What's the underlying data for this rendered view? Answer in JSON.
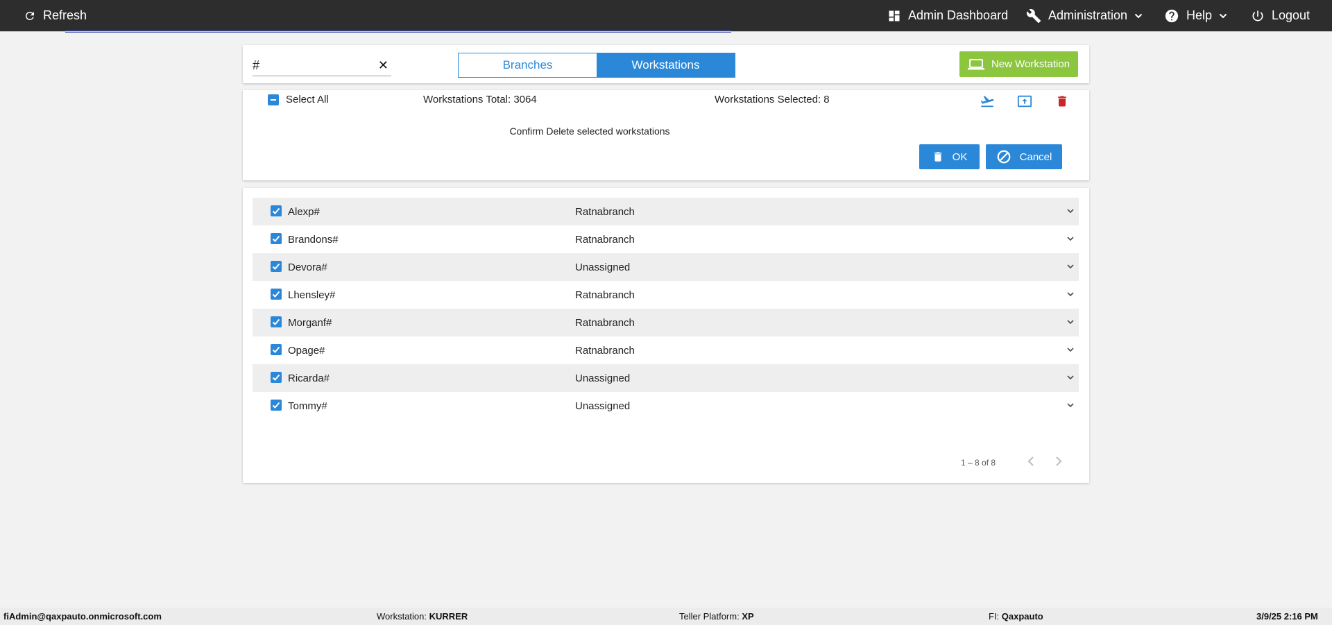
{
  "topbar": {
    "refresh": "Refresh",
    "admin_dashboard": "Admin Dashboard",
    "administration": "Administration",
    "help": "Help",
    "logout": "Logout"
  },
  "search": {
    "value": "#"
  },
  "toggle": {
    "branches": "Branches",
    "workstations": "Workstations",
    "active": "Workstations"
  },
  "new_workstation": "New Workstation",
  "selection": {
    "select_all": "Select All",
    "total": "Workstations Total: 3064",
    "selected": "Workstations Selected: 8"
  },
  "confirm": {
    "message": "Confirm Delete selected workstations",
    "ok": "OK",
    "cancel": "Cancel"
  },
  "workstations": [
    {
      "name": "Alexp#",
      "branch": "Ratnabranch",
      "checked": true
    },
    {
      "name": "Brandons#",
      "branch": "Ratnabranch",
      "checked": true
    },
    {
      "name": "Devora#",
      "branch": "Unassigned",
      "checked": true
    },
    {
      "name": "Lhensley#",
      "branch": "Ratnabranch",
      "checked": true
    },
    {
      "name": "Morganf#",
      "branch": "Ratnabranch",
      "checked": true
    },
    {
      "name": "Opage#",
      "branch": "Ratnabranch",
      "checked": true
    },
    {
      "name": "Ricarda#",
      "branch": "Unassigned",
      "checked": true
    },
    {
      "name": "Tommy#",
      "branch": "Unassigned",
      "checked": true
    }
  ],
  "pager": {
    "range": "1 – 8 of 8"
  },
  "footer": {
    "user": "fiAdmin@qaxpauto.onmicrosoft.com",
    "workstation_label": "Workstation:",
    "workstation_value": "KURRER",
    "platform_label": "Teller Platform:",
    "platform_value": "XP",
    "fi_label": "FI:",
    "fi_value": "Qaxpauto",
    "datetime": "3/9/25 2:16 PM"
  },
  "colors": {
    "primary": "#2b88d8",
    "success": "#8cc63f",
    "danger": "#c62828",
    "topbar": "#2d2d2d"
  }
}
